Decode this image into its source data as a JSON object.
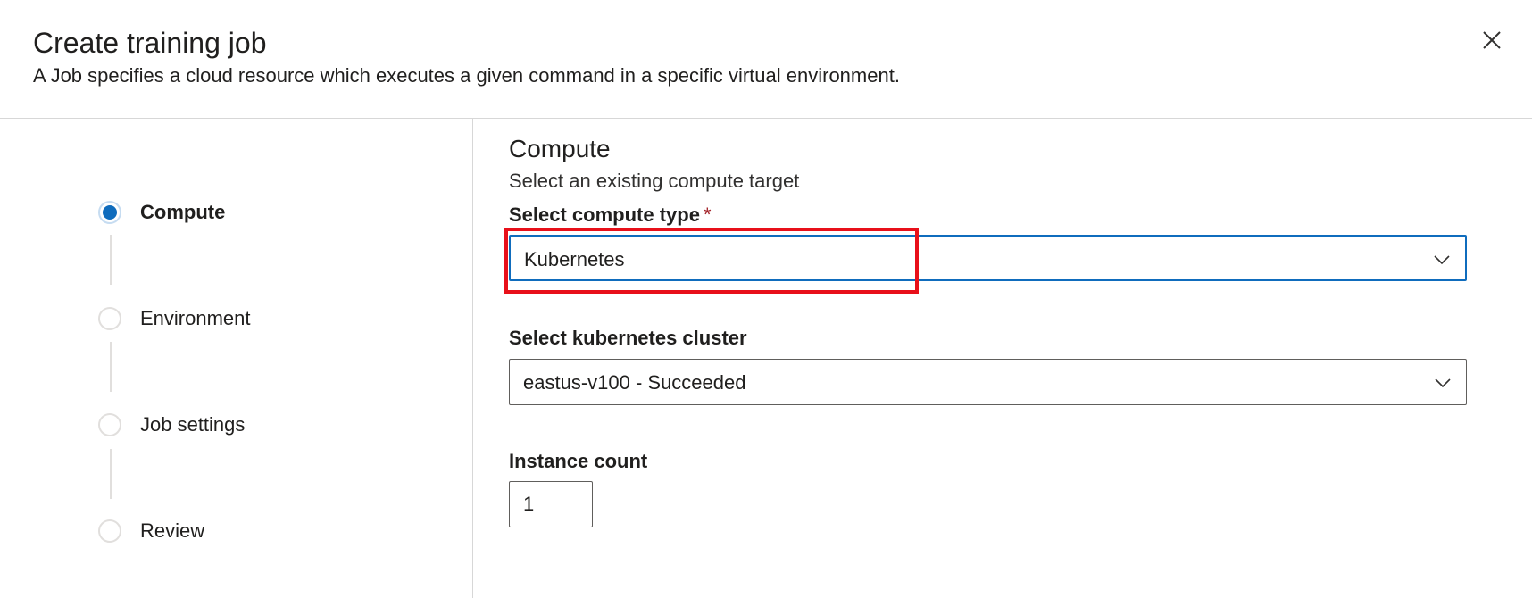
{
  "header": {
    "title": "Create training job",
    "subtitle": "A Job specifies a cloud resource which executes a given command in a specific virtual environment."
  },
  "icons": {
    "close": "close-icon",
    "chevron": "chevron-down-icon"
  },
  "steps": [
    {
      "label": "Compute",
      "active": true
    },
    {
      "label": "Environment",
      "active": false
    },
    {
      "label": "Job settings",
      "active": false
    },
    {
      "label": "Review",
      "active": false
    }
  ],
  "form": {
    "section_title": "Compute",
    "section_desc": "Select an existing compute target",
    "compute_type": {
      "label": "Select compute type",
      "required_mark": "*",
      "value": "Kubernetes"
    },
    "cluster": {
      "label": "Select kubernetes cluster",
      "value": "eastus-v100 - Succeeded"
    },
    "instance_count": {
      "label": "Instance count",
      "value": "1"
    }
  },
  "colors": {
    "accent": "#0f6cbd",
    "highlight": "#e8101a",
    "required": "#a4262c"
  }
}
